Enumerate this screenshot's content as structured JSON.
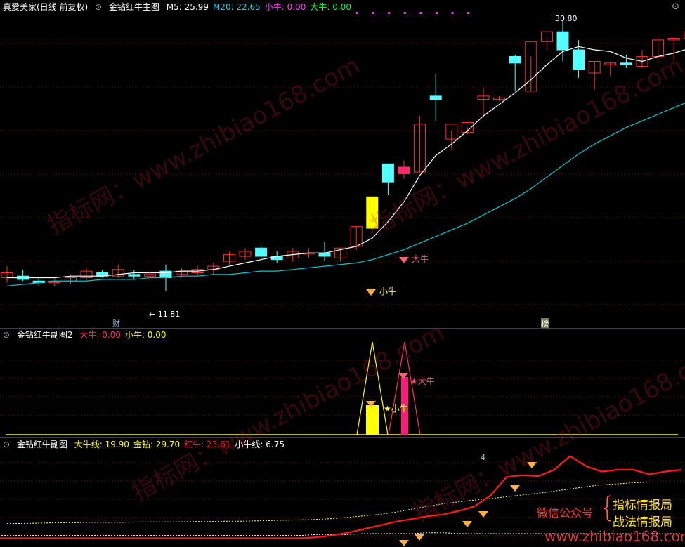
{
  "main": {
    "window_title": "真爱美家(日线 前复权)",
    "indicator": "金钻红牛主图",
    "values": [
      {
        "label": "M5:",
        "value": "25.99",
        "color": "#ffffff"
      },
      {
        "label": "M20:",
        "value": "22.65",
        "color": "#00d8e0"
      },
      {
        "label": "小牛:",
        "value": "0.00",
        "color": "#ff3cff"
      },
      {
        "label": "大牛:",
        "value": "0.00",
        "color": "#00ff33"
      }
    ],
    "high_label": "30.80",
    "low_label": "11.81",
    "tag_cai": "财",
    "tag_bang": "榜",
    "sig_xiaoniu": "小牛",
    "sig_daniu": "大牛",
    "candles": [
      [
        15.2,
        15.9,
        14.9,
        15.5
      ],
      [
        15.3,
        15.7,
        15.0,
        15.1
      ],
      [
        15.0,
        15.2,
        14.7,
        14.9
      ],
      [
        14.9,
        15.2,
        14.7,
        15.0
      ],
      [
        15.0,
        15.4,
        14.8,
        15.2
      ],
      [
        15.2,
        15.8,
        15.0,
        15.6
      ],
      [
        15.5,
        15.7,
        15.2,
        15.3
      ],
      [
        15.3,
        16.0,
        15.2,
        15.7
      ],
      [
        15.4,
        15.7,
        15.1,
        15.3
      ],
      [
        15.3,
        15.6,
        15.0,
        15.4
      ],
      [
        15.6,
        16.0,
        14.4,
        15.2
      ],
      [
        15.4,
        15.8,
        15.2,
        15.6
      ],
      [
        15.5,
        15.9,
        15.3,
        15.7
      ],
      [
        15.7,
        16.1,
        15.4,
        15.9
      ],
      [
        16.2,
        16.8,
        16.0,
        16.6
      ],
      [
        16.5,
        17.0,
        16.3,
        16.8
      ],
      [
        17.0,
        17.3,
        16.3,
        16.5
      ],
      [
        16.5,
        16.8,
        16.1,
        16.3
      ],
      [
        16.4,
        17.0,
        16.2,
        16.8
      ],
      [
        16.7,
        17.0,
        16.4,
        16.7
      ],
      [
        16.7,
        17.4,
        16.2,
        16.5
      ],
      [
        16.4,
        16.9,
        16.2,
        17.0
      ],
      [
        17.1,
        18.3,
        16.9,
        18.3
      ],
      [
        18.2,
        20.1,
        17.9,
        20.1
      ],
      [
        22.1,
        22.1,
        20.2,
        21.0
      ],
      [
        21.5,
        22.3,
        21.2,
        21.9
      ],
      [
        21.6,
        25.0,
        21.6,
        24.5
      ],
      [
        26.2,
        27.5,
        24.7,
        26.0
      ],
      [
        23.6,
        24.1,
        23.0,
        24.5
      ],
      [
        24.0,
        24.3,
        23.9,
        24.6
      ],
      [
        26.0,
        26.7,
        24.9,
        26.2
      ],
      [
        26.0,
        26.2,
        25.9,
        26.1
      ],
      [
        28.6,
        28.7,
        26.5,
        28.2
      ],
      [
        26.5,
        28.6,
        26.5,
        29.5
      ],
      [
        29.5,
        29.8,
        29.0,
        30.1
      ],
      [
        30.1,
        30.8,
        28.3,
        29.0
      ],
      [
        29.0,
        29.6,
        27.3,
        27.8
      ],
      [
        27.6,
        28.3,
        26.6,
        28.3
      ],
      [
        28.1,
        28.3,
        27.4,
        28.2
      ],
      [
        28.2,
        28.7,
        27.9,
        28.1
      ],
      [
        28.0,
        29.0,
        27.9,
        28.6
      ],
      [
        28.6,
        29.8,
        28.2,
        29.6
      ],
      [
        29.6,
        29.8,
        28.4,
        29.7
      ],
      [
        29.7,
        30.3,
        28.6,
        30.1
      ]
    ],
    "ma5": [
      15.2,
      15.2,
      15.2,
      15.2,
      15.3,
      15.3,
      15.3,
      15.4,
      15.5,
      15.5,
      15.5,
      15.6,
      15.6,
      15.7,
      15.9,
      16.1,
      16.3,
      16.5,
      16.6,
      16.7,
      16.7,
      16.9,
      17.1,
      17.6,
      18.6,
      19.8,
      21.4,
      22.6,
      23.3,
      24.1,
      25.0,
      25.7,
      26.4,
      27.2,
      28.1,
      28.9,
      29.2,
      29.0,
      28.9,
      28.5,
      28.3,
      28.6,
      28.8,
      29.1
    ],
    "ma20": [
      14.7,
      14.8,
      14.9,
      15.0,
      15.0,
      15.0,
      15.1,
      15.1,
      15.1,
      15.2,
      15.2,
      15.3,
      15.3,
      15.4,
      15.4,
      15.5,
      15.6,
      15.6,
      15.7,
      15.8,
      15.9,
      16.0,
      16.1,
      16.3,
      16.6,
      16.9,
      17.3,
      17.7,
      18.1,
      18.5,
      19.0,
      19.5,
      20.0,
      20.6,
      21.3,
      22.0,
      22.7,
      23.3,
      23.8,
      24.3,
      24.7,
      25.1,
      25.5,
      25.9
    ],
    "top_dots": 8
  },
  "sub2": {
    "indicator": "金钻红牛副图2",
    "values": [
      {
        "label": "大牛:",
        "value": "0.00",
        "color": "#ff2a6a"
      },
      {
        "label": "小牛:",
        "value": "0.00",
        "color": "#ffff00"
      }
    ],
    "sig_xiaoniu": "小牛",
    "sig_daniu": "大牛"
  },
  "sub1": {
    "indicator": "金钻红牛副图",
    "values": [
      {
        "label": "大牛线:",
        "value": "19.90",
        "color": "#ffff00"
      },
      {
        "label": "金钻:",
        "value": "29.70",
        "color": "#ffff00"
      },
      {
        "label": "红牛:",
        "value": "23.61",
        "color": "#ff2020"
      },
      {
        "label": "小牛线:",
        "value": "6.75",
        "color": "#ffffff"
      }
    ],
    "label_4": "4",
    "wechat_label": "微信公众号",
    "brand_1": "指标情报局",
    "brand_2": "战法情报局",
    "red_line": [
      5,
      5,
      5,
      5,
      5,
      5,
      5,
      5,
      5,
      5,
      5,
      5,
      5,
      5,
      5,
      5,
      5,
      5,
      5,
      5,
      5,
      5,
      5,
      6,
      8,
      11,
      15,
      19,
      23,
      26,
      29,
      31,
      35,
      40,
      52,
      72,
      74,
      73,
      80,
      95,
      84,
      78,
      80,
      80,
      75,
      78,
      80
    ],
    "yellow_line": [
      19.0,
      19.0,
      19.1,
      19.2,
      19.2,
      19.3,
      19.3,
      19.3,
      19.4,
      19.4,
      19.4,
      19.5,
      19.5,
      19.6,
      19.6,
      19.7,
      19.8,
      19.9,
      20.0,
      20.2,
      20.5,
      20.9,
      21.3,
      21.9,
      22.7,
      23.5,
      24.2,
      24.7,
      25.2,
      25.6,
      26.1,
      26.6,
      27.1,
      27.7,
      28.3,
      28.9,
      29.2,
      29.5,
      29.7
    ],
    "white_line": [
      8,
      8,
      8,
      8,
      8,
      8,
      8,
      8,
      8,
      8,
      8,
      8,
      8,
      8,
      8,
      8,
      8,
      8,
      8,
      8,
      8,
      8,
      8,
      9,
      9,
      9,
      10,
      10,
      10,
      10,
      11,
      11,
      10,
      10,
      10,
      10,
      10,
      10,
      10,
      10,
      10,
      10,
      10,
      10,
      10,
      10,
      10
    ]
  },
  "watermarks": [
    "指标网：www.zhibiao168.com",
    "指标网：www.zhibiao168.com",
    "指标网：www.zhibiao168.com",
    "指标网：www.zhibiao168.com"
  ],
  "footer_url": "www.zhibiao168.com"
}
